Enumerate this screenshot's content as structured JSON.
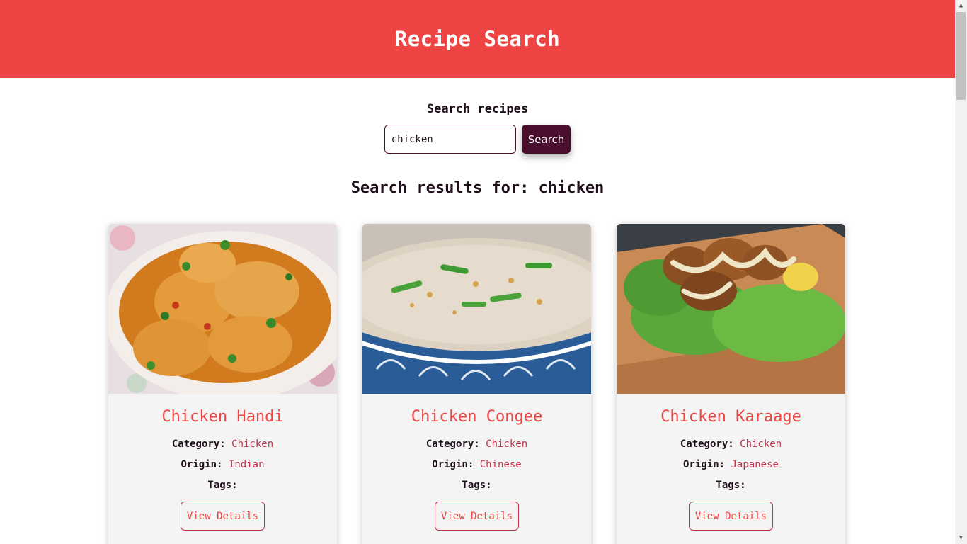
{
  "header": {
    "title": "Recipe Search"
  },
  "search": {
    "label": "Search recipes",
    "value": "chicken",
    "button_label": "Search"
  },
  "results": {
    "heading": "Search results for: chicken"
  },
  "card_labels": {
    "category": "Category:",
    "origin": "Origin:",
    "tags": "Tags:",
    "details_button": "View Details"
  },
  "recipes": [
    {
      "title": "Chicken Handi",
      "category": "Chicken",
      "origin": "Indian",
      "image": "curry-chicken-dish"
    },
    {
      "title": "Chicken Congee",
      "category": "Chicken",
      "origin": "Chinese",
      "image": "rice-porridge-bowl"
    },
    {
      "title": "Chicken Karaage",
      "category": "Chicken",
      "origin": "Japanese",
      "image": "fried-chicken-on-board"
    }
  ],
  "colors": {
    "accent": "#ef4444",
    "dark": "#4a0e2e",
    "card_bg": "#f4f4f4"
  }
}
